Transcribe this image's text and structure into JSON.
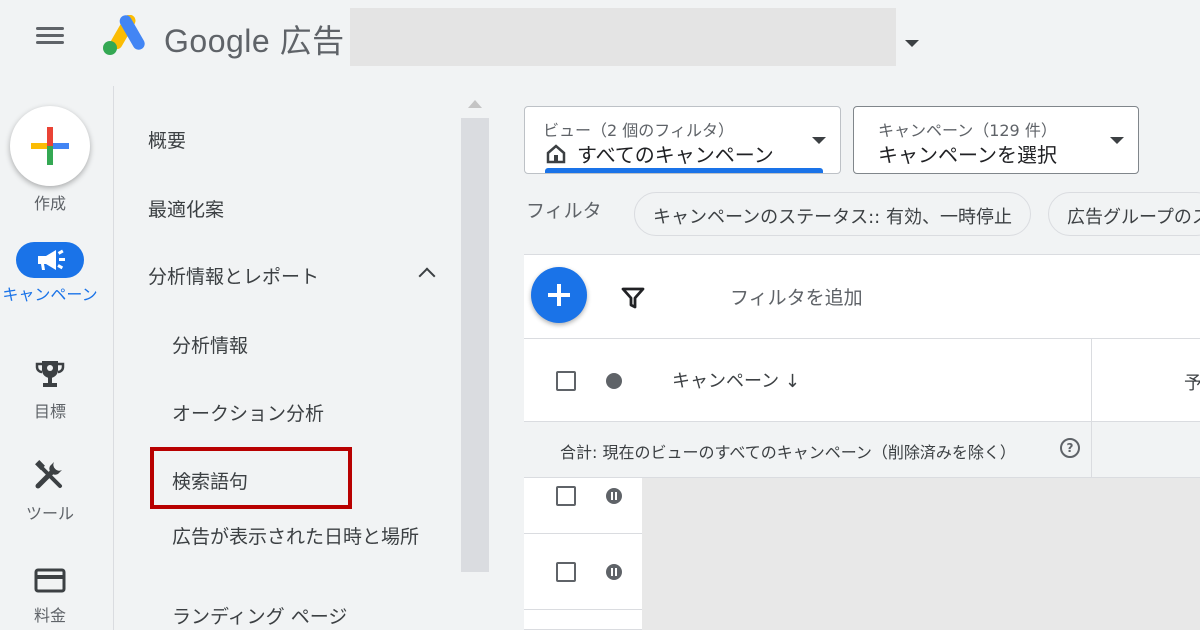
{
  "header": {
    "brand": "Google 広告"
  },
  "rail": {
    "create_label": "作成",
    "campaign_label": "キャンペーン",
    "goals_label": "目標",
    "tools_label": "ツール",
    "billing_label": "料金"
  },
  "nav": {
    "overview": "概要",
    "recommendations": "最適化案",
    "insights_reports": "分析情報とレポート",
    "insights": "分析情報",
    "auction_insights": "オークション分析",
    "search_terms": "検索語句",
    "when_where_ads_showed": "広告が表示された日時と場所",
    "landing_pages": "ランディング ページ"
  },
  "view_selector": {
    "label": "ビュー（2 個のフィルタ）",
    "value": "すべてのキャンペーン"
  },
  "campaign_selector": {
    "label": "キャンペーン（129 件）",
    "value": "キャンペーンを選択"
  },
  "filters": {
    "label": "フィルタ",
    "chip_status": "キャンペーンのステータス:: 有効、一時停止",
    "chip_adgroup": "広告グループのス"
  },
  "toolbar": {
    "add_filter": "フィルタを追加"
  },
  "table": {
    "col_campaign": "キャンペーン ↓",
    "col_budget_partial": "予",
    "total_row": "合計: 現在のビューのすべてのキャンペーン（削除済みを除く）"
  },
  "colors": {
    "accent": "#1a73e8",
    "highlight": "#b80000",
    "background": "#f1f3f4"
  },
  "icons": {
    "menu": "menu-icon",
    "create": "plus-multicolor-icon",
    "campaign": "megaphone-icon",
    "goals": "trophy-icon",
    "tools": "tools-icon",
    "billing": "credit-card-icon",
    "home": "home-icon",
    "filter": "filter-funnel-icon",
    "help": "help-circle-icon"
  }
}
